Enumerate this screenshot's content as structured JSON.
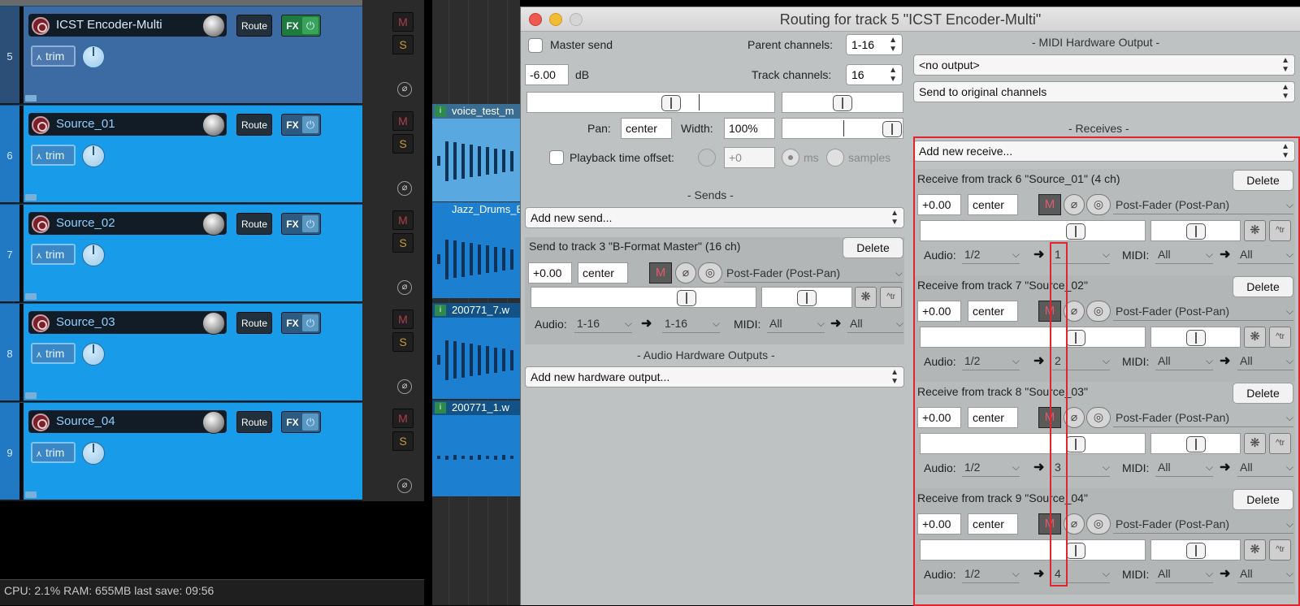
{
  "tracks": [
    {
      "num": "5",
      "name": "ICST Encoder-Multi",
      "route": "Route",
      "fx": "FX",
      "trim": "trim",
      "selected": true,
      "fx_active": true
    },
    {
      "num": "6",
      "name": "Source_01",
      "route": "Route",
      "fx": "FX",
      "trim": "trim",
      "selected": false,
      "fx_active": false
    },
    {
      "num": "7",
      "name": "Source_02",
      "route": "Route",
      "fx": "FX",
      "trim": "trim",
      "selected": false,
      "fx_active": false
    },
    {
      "num": "8",
      "name": "Source_03",
      "route": "Route",
      "fx": "FX",
      "trim": "trim",
      "selected": false,
      "fx_active": false
    },
    {
      "num": "9",
      "name": "Source_04",
      "route": "Route",
      "fx": "FX",
      "trim": "trim",
      "selected": false,
      "fx_active": false
    }
  ],
  "mixer": {
    "mute": "M",
    "solo": "S",
    "phase": "⌀"
  },
  "items": [
    "voice_test_m",
    "Jazz_Drums_Ex",
    "200771_7.w",
    "200771_1.w"
  ],
  "status": "CPU: 2.1%  RAM: 655MB  last save: 09:56",
  "dialog": {
    "title": "Routing for track 5 \"ICST Encoder-Multi\"",
    "master_send": "Master send",
    "parent_channels_label": "Parent channels:",
    "parent_channels": "1-16",
    "volume": "-6.00",
    "db": "dB",
    "track_channels_label": "Track channels:",
    "track_channels": "16",
    "pan_label": "Pan:",
    "pan": "center",
    "width_label": "Width:",
    "width": "100%",
    "playback_offset": "Playback time offset:",
    "offset_value": "+0",
    "ms": "ms",
    "samples": "samples",
    "sends_header": "-  Sends  -",
    "add_send": "Add new send...",
    "send": {
      "title": "Send to track 3 \"B-Format Master\" (16 ch)",
      "delete": "Delete",
      "vol": "+0.00",
      "pan": "center",
      "mode": "Post-Fader (Post-Pan)",
      "audio_label": "Audio:",
      "audio_src": "1-16",
      "audio_dst": "1-16",
      "midi_label": "MIDI:",
      "midi_src": "All",
      "midi_dst": "All"
    },
    "hw_header": "-  Audio Hardware Outputs  -",
    "add_hw": "Add new hardware output...",
    "midi_hw_header": "-  MIDI Hardware Output  -",
    "midi_output": "<no output>",
    "midi_channels": "Send to original channels",
    "receives_header": "-  Receives  -",
    "add_receive": "Add new receive...",
    "receives": [
      {
        "title": "Receive from track 6 \"Source_01\" (4 ch)",
        "delete": "Delete",
        "vol": "+0.00",
        "pan": "center",
        "mode": "Post-Fader (Post-Pan)",
        "audio_label": "Audio:",
        "audio_src": "1/2",
        "audio_dst": "1",
        "midi_label": "MIDI:",
        "midi_src": "All",
        "midi_dst": "All"
      },
      {
        "title": "Receive from track 7 \"Source_02\"",
        "delete": "Delete",
        "vol": "+0.00",
        "pan": "center",
        "mode": "Post-Fader (Post-Pan)",
        "audio_label": "Audio:",
        "audio_src": "1/2",
        "audio_dst": "2",
        "midi_label": "MIDI:",
        "midi_src": "All",
        "midi_dst": "All"
      },
      {
        "title": "Receive from track 8 \"Source_03\"",
        "delete": "Delete",
        "vol": "+0.00",
        "pan": "center",
        "mode": "Post-Fader (Post-Pan)",
        "audio_label": "Audio:",
        "audio_src": "1/2",
        "audio_dst": "3",
        "midi_label": "MIDI:",
        "midi_src": "All",
        "midi_dst": "All"
      },
      {
        "title": "Receive from track 9 \"Source_04\"",
        "delete": "Delete",
        "vol": "+0.00",
        "pan": "center",
        "mode": "Post-Fader (Post-Pan)",
        "audio_label": "Audio:",
        "audio_src": "1/2",
        "audio_dst": "4",
        "midi_label": "MIDI:",
        "midi_src": "All",
        "midi_dst": "All"
      }
    ]
  },
  "colors": {
    "highlight": "#e1242d",
    "track_selected": "#3c6aa3",
    "track": "#189be9"
  }
}
